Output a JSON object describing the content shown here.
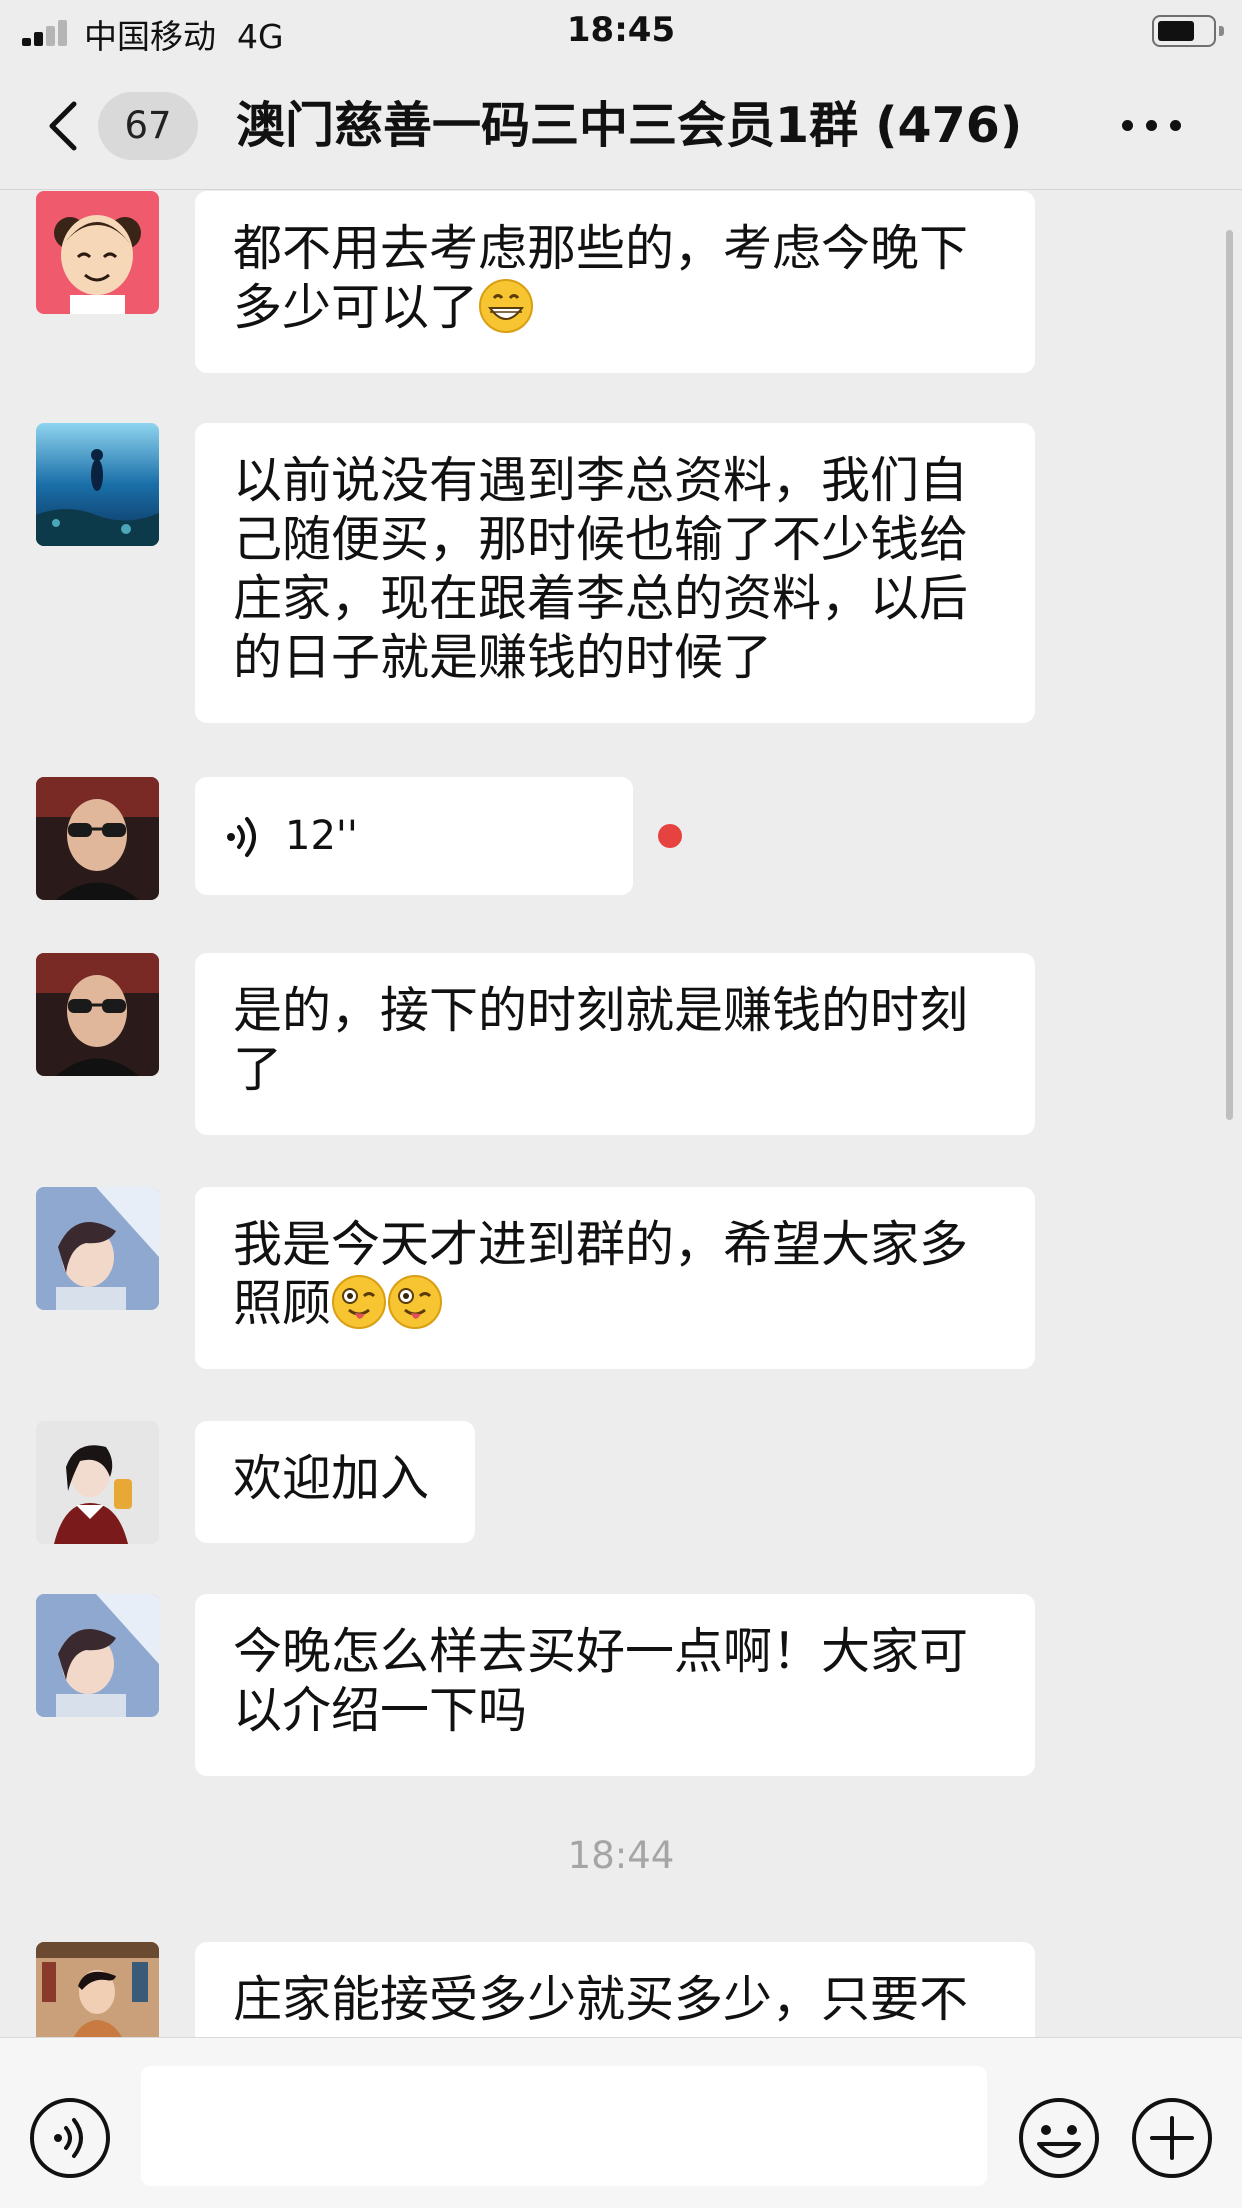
{
  "status_bar": {
    "carrier": "中国移动",
    "network": "4G",
    "time": "18:45"
  },
  "header": {
    "unread_count": "67",
    "title": "澳门慈善一码三中三会员1群 (476)"
  },
  "messages": [
    {
      "kind": "text",
      "avatar": "cartoon-avatar",
      "lines": [
        "都不用去考虑那些的，考虑今晚下",
        "多少可以了"
      ],
      "emoji": [
        "grin-emoji"
      ]
    },
    {
      "kind": "text",
      "avatar": "diver-avatar",
      "lines": [
        "以前说没有遇到李总资料，我们自",
        "己随便买，那时候也输了不少钱给",
        "庄家，现在跟着李总的资料，以后",
        "的日子就是赚钱的时候了"
      ]
    },
    {
      "kind": "voice",
      "avatar": "sunglasses-man-avatar",
      "duration": "12''",
      "unread": true
    },
    {
      "kind": "text",
      "avatar": "sunglasses-man-avatar",
      "lines": [
        "是的，接下的时刻就是赚钱的时刻",
        "了"
      ]
    },
    {
      "kind": "text",
      "avatar": "anime-girl-avatar",
      "lines": [
        "我是今天才进到群的，希望大家多",
        "照顾"
      ],
      "emoji": [
        "wink-tongue-emoji",
        "wink-tongue-emoji"
      ]
    },
    {
      "kind": "text",
      "avatar": "woman-avatar",
      "lines": [
        "欢迎加入"
      ]
    },
    {
      "kind": "text",
      "avatar": "anime-girl-avatar",
      "lines": [
        "今晚怎么样去买好一点啊！大家可",
        "以介绍一下吗"
      ]
    },
    {
      "kind": "timestamp",
      "text": "18:44"
    },
    {
      "kind": "text",
      "avatar": "man-books-avatar",
      "lines": [
        "庄家能接受多少就买多少，只要不"
      ]
    }
  ],
  "input_bar": {
    "placeholder": "",
    "icons": [
      "voice-icon",
      "emoji-icon",
      "plus-icon"
    ]
  },
  "colors": {
    "background": "#ededed",
    "bubble": "#ffffff",
    "unread_dot": "#e64340",
    "timestamp": "#a5a5a5"
  }
}
